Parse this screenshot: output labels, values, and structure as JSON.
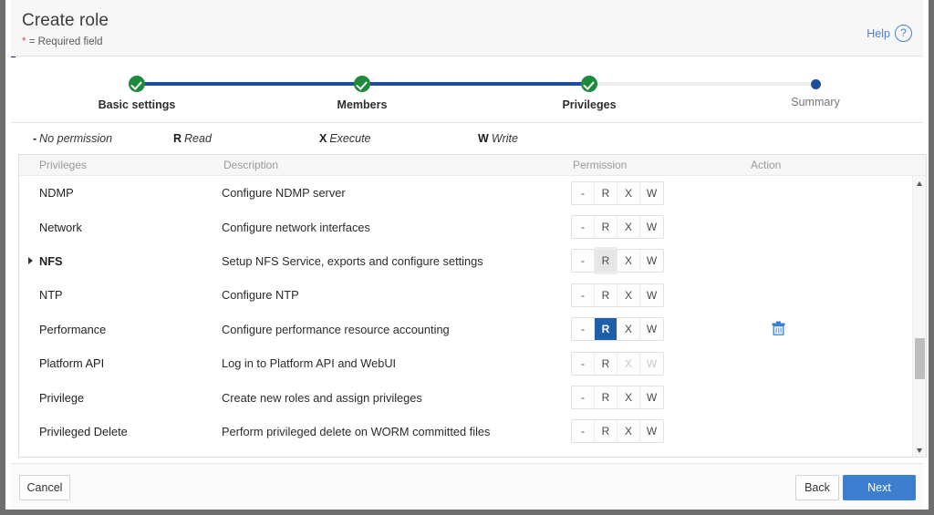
{
  "header": {
    "title": "Create role",
    "required_note_star": "*",
    "required_note": "= Required field",
    "help_label": "Help",
    "help_icon": "question-circle-icon"
  },
  "stepper": {
    "steps": [
      {
        "label": "Basic settings",
        "state": "done"
      },
      {
        "label": "Members",
        "state": "done"
      },
      {
        "label": "Privileges",
        "state": "done"
      },
      {
        "label": "Summary",
        "state": "current"
      }
    ]
  },
  "legend": [
    {
      "key": "-",
      "text": "No permission"
    },
    {
      "key": "R",
      "text": "Read"
    },
    {
      "key": "X",
      "text": "Execute"
    },
    {
      "key": "W",
      "text": "Write"
    }
  ],
  "table": {
    "columns": [
      "Privileges",
      "Description",
      "Permission",
      "Action"
    ],
    "permission_options": [
      "-",
      "R",
      "X",
      "W"
    ],
    "rows": [
      {
        "privilege": "NDMP",
        "description": "Configure NDMP server",
        "expandable": false,
        "selected": null,
        "hovered": null,
        "disabled": [],
        "action": null
      },
      {
        "privilege": "Network",
        "description": "Configure network interfaces",
        "expandable": false,
        "selected": null,
        "hovered": null,
        "disabled": [],
        "action": null
      },
      {
        "privilege": "NFS",
        "description": "Setup NFS Service, exports and configure settings",
        "expandable": true,
        "selected": null,
        "hovered": "R",
        "disabled": [],
        "action": null
      },
      {
        "privilege": "NTP",
        "description": "Configure NTP",
        "expandable": false,
        "selected": null,
        "hovered": null,
        "disabled": [],
        "action": null
      },
      {
        "privilege": "Performance",
        "description": "Configure performance resource accounting",
        "expandable": false,
        "selected": "R",
        "hovered": null,
        "disabled": [],
        "action": "delete-icon"
      },
      {
        "privilege": "Platform API",
        "description": "Log in to Platform API and WebUI",
        "expandable": false,
        "selected": null,
        "hovered": null,
        "disabled": [
          "X",
          "W"
        ],
        "action": null
      },
      {
        "privilege": "Privilege",
        "description": "Create new roles and assign privileges",
        "expandable": false,
        "selected": null,
        "hovered": null,
        "disabled": [],
        "action": null
      },
      {
        "privilege": "Privileged Delete",
        "description": "Perform privileged delete on WORM committed files",
        "expandable": false,
        "selected": null,
        "hovered": null,
        "disabled": [],
        "action": null
      }
    ]
  },
  "footer": {
    "cancel_label": "Cancel",
    "back_label": "Back",
    "next_label": "Next"
  },
  "colors": {
    "accent_blue": "#1c4e9c",
    "primary_button": "#3c7fd0",
    "step_done_green": "#1e8a3c",
    "selected_perm": "#1d5fa8",
    "link_blue": "#4a7fd4",
    "left_accent_navy": "#13365e"
  }
}
